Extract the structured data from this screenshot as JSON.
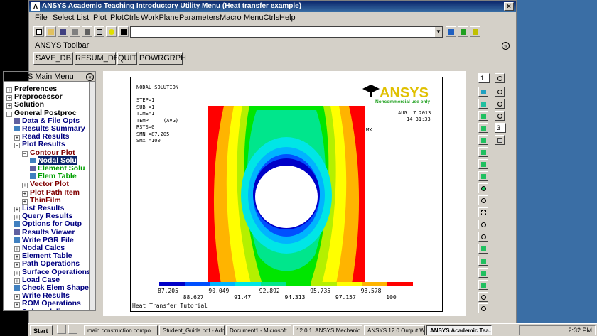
{
  "window": {
    "title": "ANSYS Academic Teaching Introductory Utility Menu (Heat transfer example)"
  },
  "menubar": [
    "File",
    "Select",
    "List",
    "Plot",
    "PlotCtrls",
    "WorkPlane",
    "Parameters",
    "Macro",
    "MenuCtrls",
    "Help"
  ],
  "ansys_toolbar": {
    "title": "ANSYS Toolbar",
    "buttons": [
      "SAVE_DB",
      "RESUM_DB",
      "QUIT",
      "POWRGRPH"
    ]
  },
  "main_menu": {
    "title": "ANSYS Main Menu",
    "items": [
      {
        "label": "Preferences",
        "indent": 0,
        "kind": "plus",
        "color": "#000000"
      },
      {
        "label": "Preprocessor",
        "indent": 0,
        "kind": "plus",
        "color": "#000000"
      },
      {
        "label": "Solution",
        "indent": 0,
        "kind": "plus",
        "color": "#000000"
      },
      {
        "label": "General Postproc",
        "indent": 0,
        "kind": "minus",
        "color": "#000000"
      },
      {
        "label": "Data & File Opts",
        "indent": 1,
        "kind": "square",
        "color": "#000080"
      },
      {
        "label": "Results Summary",
        "indent": 1,
        "kind": "square",
        "color": "#000080"
      },
      {
        "label": "Read Results",
        "indent": 1,
        "kind": "plus",
        "color": "#000080"
      },
      {
        "label": "Plot Results",
        "indent": 1,
        "kind": "minus",
        "color": "#000080"
      },
      {
        "label": "Contour Plot",
        "indent": 2,
        "kind": "minus",
        "color": "#800000"
      },
      {
        "label": "Nodal Solu",
        "indent": 3,
        "kind": "square",
        "color": "#008000",
        "selected": true
      },
      {
        "label": "Element Solu",
        "indent": 3,
        "kind": "square",
        "color": "#00a000"
      },
      {
        "label": "Elem Table",
        "indent": 3,
        "kind": "square",
        "color": "#00a000"
      },
      {
        "label": "Vector Plot",
        "indent": 2,
        "kind": "plus",
        "color": "#800000"
      },
      {
        "label": "Plot Path Item",
        "indent": 2,
        "kind": "plus",
        "color": "#800000"
      },
      {
        "label": "ThinFilm",
        "indent": 2,
        "kind": "plus",
        "color": "#800000"
      },
      {
        "label": "List Results",
        "indent": 1,
        "kind": "plus",
        "color": "#000080"
      },
      {
        "label": "Query Results",
        "indent": 1,
        "kind": "plus",
        "color": "#000080"
      },
      {
        "label": "Options for Outp",
        "indent": 1,
        "kind": "square",
        "color": "#000080"
      },
      {
        "label": "Results Viewer",
        "indent": 1,
        "kind": "square",
        "color": "#000080"
      },
      {
        "label": "Write PGR File",
        "indent": 1,
        "kind": "square",
        "color": "#000080"
      },
      {
        "label": "Nodal Calcs",
        "indent": 1,
        "kind": "plus",
        "color": "#000080"
      },
      {
        "label": "Element Table",
        "indent": 1,
        "kind": "plus",
        "color": "#000080"
      },
      {
        "label": "Path Operations",
        "indent": 1,
        "kind": "plus",
        "color": "#000080"
      },
      {
        "label": "Surface Operations",
        "indent": 1,
        "kind": "plus",
        "color": "#000080"
      },
      {
        "label": "Load Case",
        "indent": 1,
        "kind": "plus",
        "color": "#000080"
      },
      {
        "label": "Check Elem Shape",
        "indent": 1,
        "kind": "square",
        "color": "#000080"
      },
      {
        "label": "Write Results",
        "indent": 1,
        "kind": "plus",
        "color": "#000080"
      },
      {
        "label": "ROM Operations",
        "indent": 1,
        "kind": "plus",
        "color": "#000080"
      },
      {
        "label": "Submodeling",
        "indent": 1,
        "kind": "plus",
        "color": "#000080"
      }
    ]
  },
  "graphics": {
    "header": "NODAL SOLUTION",
    "info_lines": [
      "STEP=1",
      "SUB =1",
      "TIME=1",
      "TEMP     (AVG)",
      "RSYS=0",
      "SMN =87.205",
      "SMX =100"
    ],
    "logo_text": "ANSYS",
    "logo_sub": "Noncommercial use only",
    "date": "AUG  7 2013",
    "time": "14:31:33",
    "mx_label": "MX",
    "legend_top": [
      "87.205",
      "90.049",
      "92.892",
      "95.735",
      "98.578"
    ],
    "legend_bottom": [
      "88.627",
      "91.47",
      "94.313",
      "97.157",
      "100"
    ],
    "legend_colors": [
      "#0000c8",
      "#0050ff",
      "#00b4ff",
      "#00e6e6",
      "#00e68c",
      "#00e600",
      "#b4f000",
      "#ffff00",
      "#ffb400",
      "#ff0000"
    ],
    "footer": "Heat Transfer Tutorial"
  },
  "right_toolbar": {
    "dropdown_1": "1",
    "dropdown_3": "3"
  },
  "taskbar": {
    "start": "Start",
    "tasks": [
      "main construction compo...",
      "Student_Guide.pdf - Ado...",
      "Document1 - Microsoft ...",
      "12.0.1: ANSYS Mechanic...",
      "ANSYS 12.0 Output Win...",
      "ANSYS Academic Tea..."
    ],
    "clock": "2:32 PM"
  }
}
